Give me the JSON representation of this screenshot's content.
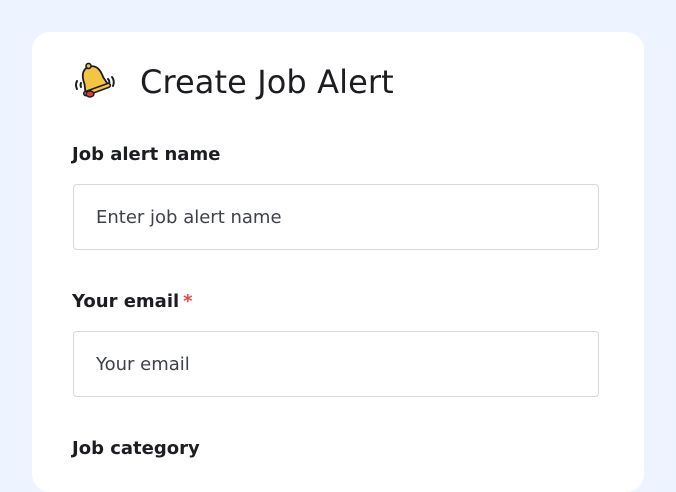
{
  "form": {
    "title": "Create Job Alert",
    "title_icon": "bell-icon",
    "fields": [
      {
        "label": "Job alert name",
        "placeholder": "Enter job alert name",
        "required": false,
        "value": ""
      },
      {
        "label": "Your email",
        "placeholder": "Your email",
        "required": true,
        "required_mark": "*",
        "value": ""
      },
      {
        "label": "Job category",
        "required": false
      }
    ]
  },
  "colors": {
    "page_bg": "#eef4ff",
    "card_bg": "#ffffff",
    "text": "#1b1d21",
    "required": "#ef4444",
    "input_border": "#d6d9de",
    "bell_yellow": "#f5c542",
    "bell_red": "#e53935"
  }
}
